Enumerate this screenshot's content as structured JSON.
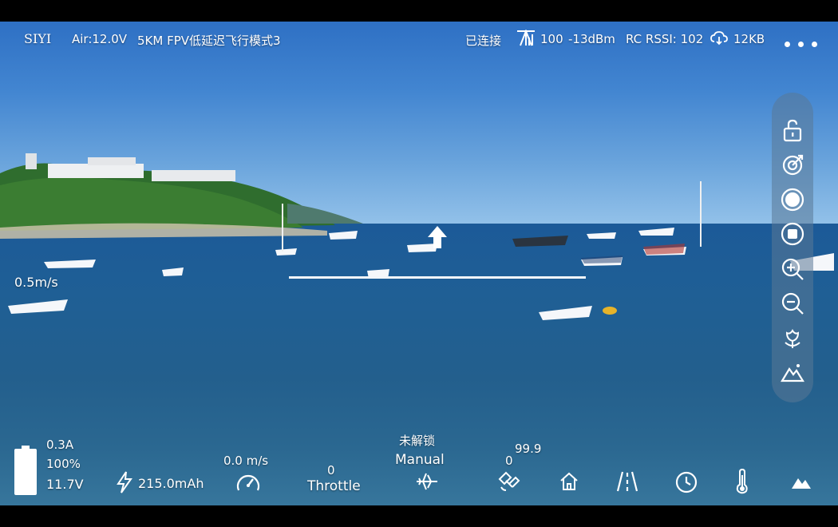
{
  "topbar": {
    "brand": "SIYI",
    "air_voltage": "Air:12.0V",
    "mode": "5KM FPV低延迟飞行模式3",
    "connection": "已连接",
    "signal": "100",
    "signal_dbm": "-13dBm",
    "rc_rssi": "RC RSSI: 102",
    "data_rate": "12KB"
  },
  "overlay": {
    "speed_label": "0.5m/s"
  },
  "bottom": {
    "current": "0.3A",
    "battery_percent": "100%",
    "voltage": "11.7V",
    "consumed": "215.0mAh",
    "ground_speed": "0.0 m/s",
    "throttle_value": "0",
    "throttle_label": "Throttle",
    "arm_status": "未解锁",
    "flight_mode": "Manual",
    "sat_count": "0",
    "hdop": "99.9"
  },
  "sidebar": {
    "icons": [
      "lock-icon",
      "target-icon",
      "record-icon",
      "stop-icon",
      "zoom-in-icon",
      "zoom-out-icon",
      "flower-icon",
      "mountain-icon"
    ]
  },
  "colors": {
    "text": "#ffffff",
    "panel": "#5a7896"
  }
}
